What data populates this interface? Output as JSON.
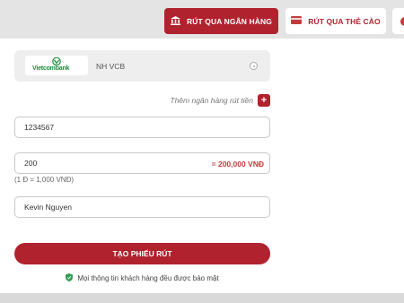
{
  "tabs": {
    "bank_label": "RÚT QUA NGÂN HÀNG",
    "card_label": "RÚT QUA THẺ CÀO",
    "third_label": ""
  },
  "bank": {
    "logo_text": "Vietcombank",
    "name": "NH VCB"
  },
  "add_bank": {
    "label": "Thêm ngân hàng rút tiền",
    "button": "+"
  },
  "form": {
    "account_number": "1234567",
    "amount": "200",
    "amount_converted": "= 200,000 VNĐ",
    "rate_note": "(1 Đ = 1,000 VNĐ)",
    "account_name": "Kevin Nguyen",
    "submit_label": "TẠO PHIẾU RÚT"
  },
  "security_note": "Mọi thông tin khách hàng đều được bảo mật",
  "colors": {
    "primary": "#b0222e",
    "accent_text": "#c43b3b",
    "brand_green": "#1f8a3d"
  },
  "icons": {
    "bank": "bank-icon",
    "card": "card-icon",
    "shield": "shield-icon",
    "radio": "radio-icon"
  }
}
